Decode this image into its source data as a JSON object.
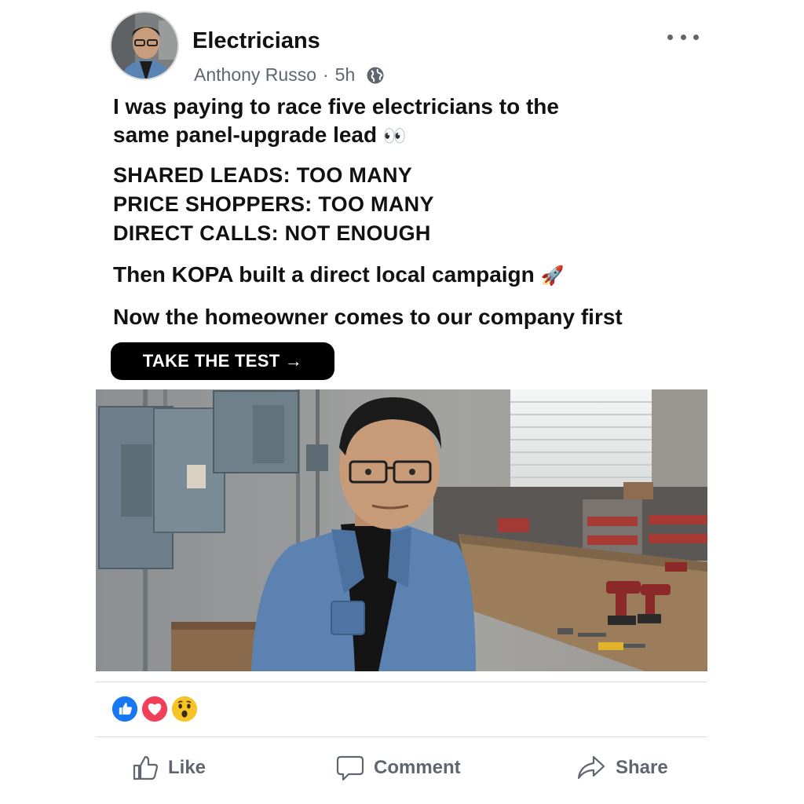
{
  "post": {
    "group_name": "Electricians",
    "author": "Anthony Russo",
    "separator": "·",
    "time": "5h",
    "lines": [
      "I was paying to race five electricians to the",
      "same panel-upgrade lead",
      "SHARED LEADS: TOO MANY",
      "PRICE SHOPPERS: TOO MANY",
      "DIRECT CALLS: NOT ENOUGH",
      "Then KOPA built a direct local campaign",
      "Now the homeowner comes to our company first"
    ],
    "emoji_eyes": "👀",
    "emoji_rocket": "🚀",
    "cta_label": "TAKE THE TEST →"
  },
  "actions": {
    "like": "Like",
    "comment": "Comment",
    "share": "Share"
  },
  "icons": [
    "more-icon",
    "globe-icon",
    "like-icon",
    "comment-icon",
    "share-icon",
    "like-reaction-icon",
    "love-reaction-icon",
    "wow-reaction-icon"
  ],
  "colors": {
    "cta_bg": "#000000",
    "like_blue": "#1877f2",
    "love_red": "#f33e58",
    "wow_yellow": "#f7c325",
    "secondary_text": "#5f6670"
  }
}
